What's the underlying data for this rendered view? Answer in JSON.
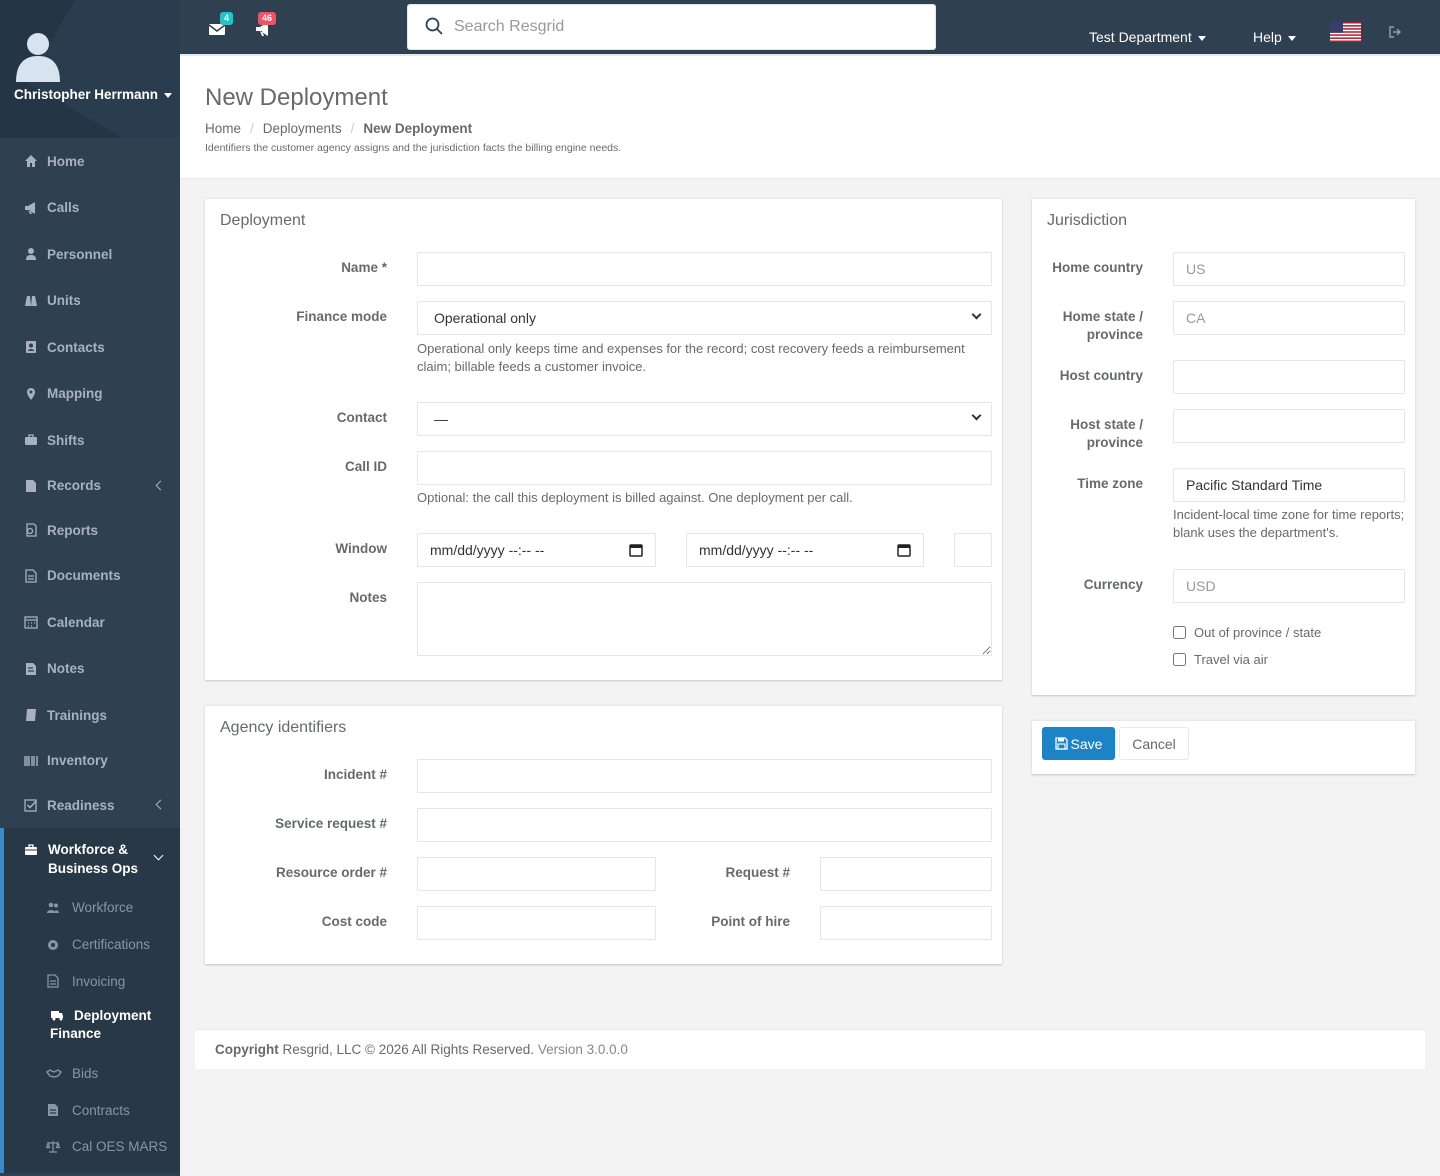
{
  "user": {
    "name": "Christopher Herrmann"
  },
  "nav": {
    "items": [
      "Home",
      "Calls",
      "Personnel",
      "Units",
      "Contacts",
      "Mapping",
      "Shifts",
      "Records",
      "Reports",
      "Documents",
      "Calendar",
      "Notes",
      "Trainings",
      "Inventory",
      "Readiness"
    ],
    "group": {
      "title_line1": "Workforce &",
      "title_line2": "Business Ops",
      "items": [
        "Workforce",
        "Certifications",
        "Invoicing",
        "Deployment Finance",
        "Bids",
        "Contracts",
        "Cal OES MARS"
      ],
      "active": "Deployment Finance"
    }
  },
  "topbar": {
    "mail_count": "4",
    "alert_count": "46",
    "search_placeholder": "Search Resgrid",
    "department": "Test Department",
    "help": "Help"
  },
  "page": {
    "title": "New Deployment",
    "breadcrumb": [
      "Home",
      "Deployments",
      "New Deployment"
    ],
    "subtitle": "Identifiers the customer agency assigns and the jurisdiction facts the billing engine needs."
  },
  "deployment": {
    "title": "Deployment",
    "name_label": "Name",
    "required_mark": "*",
    "finance_mode_label": "Finance mode",
    "finance_mode_value": "Operational only",
    "finance_mode_help": "Operational only keeps time and expenses for the record; cost recovery feeds a reimbursement claim; billable feeds a customer invoice.",
    "contact_label": "Contact",
    "contact_value": "—",
    "call_id_label": "Call ID",
    "call_id_help": "Optional: the call this deployment is billed against. One deployment per call.",
    "window_label": "Window",
    "date_placeholder": "mm/dd/yyyy  --:-- --",
    "notes_label": "Notes"
  },
  "agency": {
    "title": "Agency identifiers",
    "incident_label": "Incident #",
    "service_request_label": "Service request #",
    "resource_order_label": "Resource order #",
    "request_label": "Request #",
    "cost_code_label": "Cost code",
    "point_of_hire_label": "Point of hire"
  },
  "jurisdiction": {
    "title": "Jurisdiction",
    "home_country_label": "Home country",
    "home_country_placeholder": "US",
    "home_state_label_1": "Home state /",
    "home_state_label_2": "province",
    "home_state_placeholder": "CA",
    "host_country_label": "Host country",
    "host_state_label_1": "Host state /",
    "host_state_label_2": "province",
    "time_zone_label": "Time zone",
    "time_zone_value": "Pacific Standard Time",
    "time_zone_help": "Incident-local time zone for time reports; blank uses the department's.",
    "currency_label": "Currency",
    "currency_placeholder": "USD",
    "out_of_province_label": "Out of province / state",
    "travel_air_label": "Travel via air"
  },
  "actions": {
    "save": "Save",
    "cancel": "Cancel"
  },
  "footer": {
    "copyright_bold": "Copyright",
    "copyright_text": " Resgrid, LLC © 2026 All Rights Reserved.",
    "version": " Version 3.0.0.0"
  },
  "colors": {
    "sidebar": "#2f4050",
    "primary": "#1c84c6",
    "mail_badge": "#23c6c8",
    "alert_badge": "#ed5565"
  },
  "icons": {
    "nav": [
      "home-icon",
      "bullhorn-icon",
      "user-icon",
      "units-icon",
      "contacts-icon",
      "map-marker-icon",
      "briefcase-icon",
      "file-icon",
      "reports-icon",
      "documents-icon",
      "calendar-icon",
      "notes-icon",
      "book-icon",
      "barcode-icon",
      "check-square-icon"
    ]
  }
}
